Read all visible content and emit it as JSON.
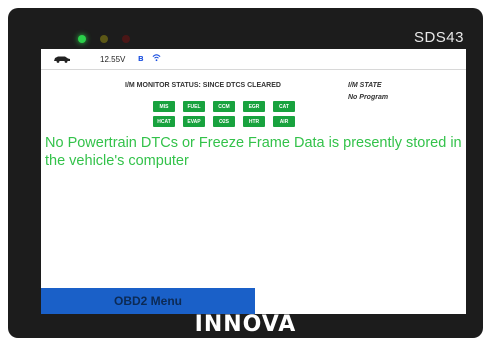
{
  "device": {
    "model": "SDS43",
    "brand": "INNOVA",
    "leds": [
      "green",
      "yellow",
      "red"
    ]
  },
  "status_bar": {
    "voltage": "12.55V",
    "bluetooth_icon": "bluetooth-icon",
    "wifi_icon": "wifi-icon",
    "vehicle_icon": "car-icon"
  },
  "im_monitor": {
    "title": "I/M MONITOR STATUS: SINCE DTCS CLEARED",
    "monitors_row1": [
      "MIS",
      "FUEL",
      "CCM",
      "EGR",
      "CAT"
    ],
    "monitors_row2": [
      "HCAT",
      "EVAP",
      "O2S",
      "HTR",
      "AIR"
    ],
    "monitor_color": "#18a23e",
    "state_label": "I/M STATE",
    "state_value": "No Program"
  },
  "message": "No Powertrain DTCs or Freeze Frame Data is presently stored in the vehicle's computer",
  "menu_button": "OBD2 Menu",
  "colors": {
    "message": "#33c24a",
    "menu_bg": "#1a60c8",
    "frame": "#1c1c1c"
  }
}
